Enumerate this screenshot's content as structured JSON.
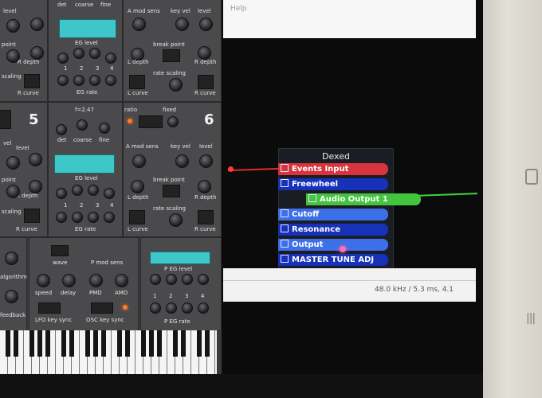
{
  "host": {
    "top_text": "Help",
    "status": "48.0 kHz / 5.3 ms, 4.1"
  },
  "node": {
    "title": "Dexed",
    "ports": [
      {
        "label": "Events Input",
        "kind": "midi-in",
        "color": "#d8343d"
      },
      {
        "label": "Freewheel",
        "kind": "control",
        "color": "#1732b8"
      },
      {
        "label": "Audio Output 1",
        "kind": "audio-out",
        "color": "#43c43f"
      },
      {
        "label": "Cutoff",
        "kind": "param",
        "color": "#3d6fe8"
      },
      {
        "label": "Resonance",
        "kind": "param",
        "color": "#1732b8"
      },
      {
        "label": "Output",
        "kind": "param",
        "color": "#3d6fe8"
      },
      {
        "label": "MASTER TUNE ADJ",
        "kind": "param",
        "color": "#1732b8"
      }
    ]
  },
  "dexed": {
    "op_upper": {
      "top_labels": [
        "det",
        "coarse",
        "fine"
      ],
      "amod_labels": [
        "A mod sens",
        "key vel",
        "level"
      ],
      "eg_level": "EG level",
      "eg_rate": "EG rate",
      "break_point": "break point",
      "l_depth": "L depth",
      "r_depth": "R depth",
      "rate_scaling": "rate scaling",
      "l_curve": "L curve",
      "r_curve": "R curve",
      "left_labels": [
        "level",
        "point",
        "R depth",
        "scaling",
        "R curve"
      ],
      "eg_nums": [
        "1",
        "2",
        "3",
        "4"
      ]
    },
    "op_lower": {
      "num_left": "5",
      "num_right": "6",
      "ratio_left": "f=2.47",
      "ratio": "ratio",
      "fixed": "fixed",
      "top_labels": [
        "det",
        "coarse",
        "fine"
      ],
      "amod_labels": [
        "A mod sens",
        "key vel",
        "level"
      ],
      "eg_level": "EG level",
      "eg_rate": "EG rate",
      "break_point": "break point",
      "l_depth": "L depth",
      "r_depth": "R depth",
      "rate_scaling": "rate scaling",
      "l_curve": "L curve",
      "r_curve": "R curve",
      "left_labels": [
        "vel",
        "level",
        "point",
        "R depth",
        "scaling",
        "R curve"
      ],
      "eg_nums": [
        "1",
        "2",
        "3",
        "4"
      ]
    },
    "global": {
      "wave": "wave",
      "p_mod_sens": "P mod sens",
      "speed": "speed",
      "delay": "delay",
      "pmd": "PMD",
      "amd": "AMD",
      "lfo_key_sync": "LFO key sync",
      "osc_key_sync": "OSC key sync",
      "p_eg_level": "P EG level",
      "p_eg_rate": "P EG rate",
      "eg_nums": [
        "1",
        "2",
        "3",
        "4"
      ],
      "left_labels": [
        "algorithm",
        "feedback"
      ]
    }
  }
}
